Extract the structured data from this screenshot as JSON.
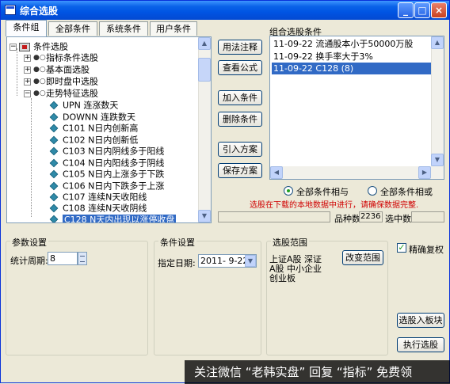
{
  "window": {
    "title": "综合选股"
  },
  "tabs": [
    {
      "label": "条件组",
      "active": true
    },
    {
      "label": "全部条件",
      "active": false
    },
    {
      "label": "系统条件",
      "active": false
    },
    {
      "label": "用户条件",
      "active": false
    }
  ],
  "tree": {
    "root": "条件选股",
    "groups": [
      "指标条件选股",
      "基本面选股",
      "即时盘中选股",
      "走势特征选股"
    ],
    "items": [
      "UPN 连涨数天",
      "DOWNN 连跌数天",
      "C101 N日内创新高",
      "C102 N日内创新低",
      "C103 N日内阴线多于阳线",
      "C104 N日内阳线多于阴线",
      "C105 N日内上涨多于下跌",
      "C106 N日内下跌多于上涨",
      "C107 连续N天收阳线",
      "C108 连续N天收阴线",
      "C128 N天内出现以涨停收盘"
    ],
    "selected_index": 10
  },
  "actions": {
    "usage": "用法注释",
    "formula": "查看公式",
    "add": "加入条件",
    "delete": "删除条件",
    "import": "引入方案",
    "save": "保存方案"
  },
  "combo": {
    "label": "组合选股条件",
    "items": [
      "11-09-22 流通股本小于50000万股",
      "11-09-22 换手率大于3%",
      "11-09-22 C128 (8)"
    ],
    "selected_index": 2
  },
  "logic": {
    "and_label": "全部条件相与",
    "or_label": "全部条件相或",
    "selected": "and"
  },
  "warning": "选股在下载的本地数据中进行，请确保数据完整.",
  "status": {
    "count_label": "品种数",
    "count_value": "2236",
    "selected_label": "选中数",
    "selected_value": ""
  },
  "params": {
    "title": "参数设置",
    "period_label": "统计周期:",
    "period_value": "8"
  },
  "condition": {
    "title": "条件设置",
    "date_label": "指定日期:",
    "date_value": "2011- 9-22"
  },
  "range": {
    "title": "选股范围",
    "line1": "上证A股 深证",
    "line2": "A股 中小企业",
    "line3": "创业板",
    "change_btn": "改变范围"
  },
  "options": {
    "exact_label": "精确复权",
    "exact_checked": true,
    "to_block": "选股入板块",
    "run": "执行选股"
  },
  "watermark": "关注微信 “老韩实盘” 回复 “指标” 免费领"
}
